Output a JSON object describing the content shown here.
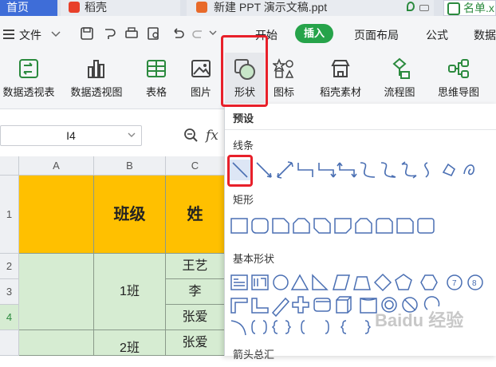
{
  "tabs": [
    {
      "label": "首页"
    },
    {
      "label": "稻壳"
    },
    {
      "label": "新建 PPT 演示文稿.ppt"
    },
    {
      "label": "名单.x"
    }
  ],
  "menu": {
    "file": "文件",
    "items": [
      "开始",
      "插入",
      "页面布局",
      "公式",
      "数据"
    ]
  },
  "ribbon": {
    "buttons": [
      "数据透视表",
      "数据透视图",
      "表格",
      "图片",
      "形状",
      "图标",
      "稻壳素材",
      "流程图",
      "思维导图"
    ]
  },
  "namebox": "I4",
  "fx": "fx",
  "grid": {
    "columns": [
      "A",
      "B",
      "C"
    ],
    "rows": [
      "1",
      "2",
      "3",
      "4"
    ],
    "header_cells": {
      "b1": "班级",
      "c1": "姓"
    },
    "class1": "1班",
    "class2": "2班",
    "names": [
      "王艺",
      "李",
      "张爱",
      "张爱"
    ]
  },
  "dropdown": {
    "preset": "预设",
    "lines": "线条",
    "rect": "矩形",
    "basic": "基本形状",
    "arrows": "箭头总汇"
  },
  "watermark": "Baidu 经验",
  "colors": {
    "accent": "#26a34a",
    "header_fill": "#ffc000",
    "cell_fill": "#d6ecd2",
    "highlight": "#e8202a"
  }
}
